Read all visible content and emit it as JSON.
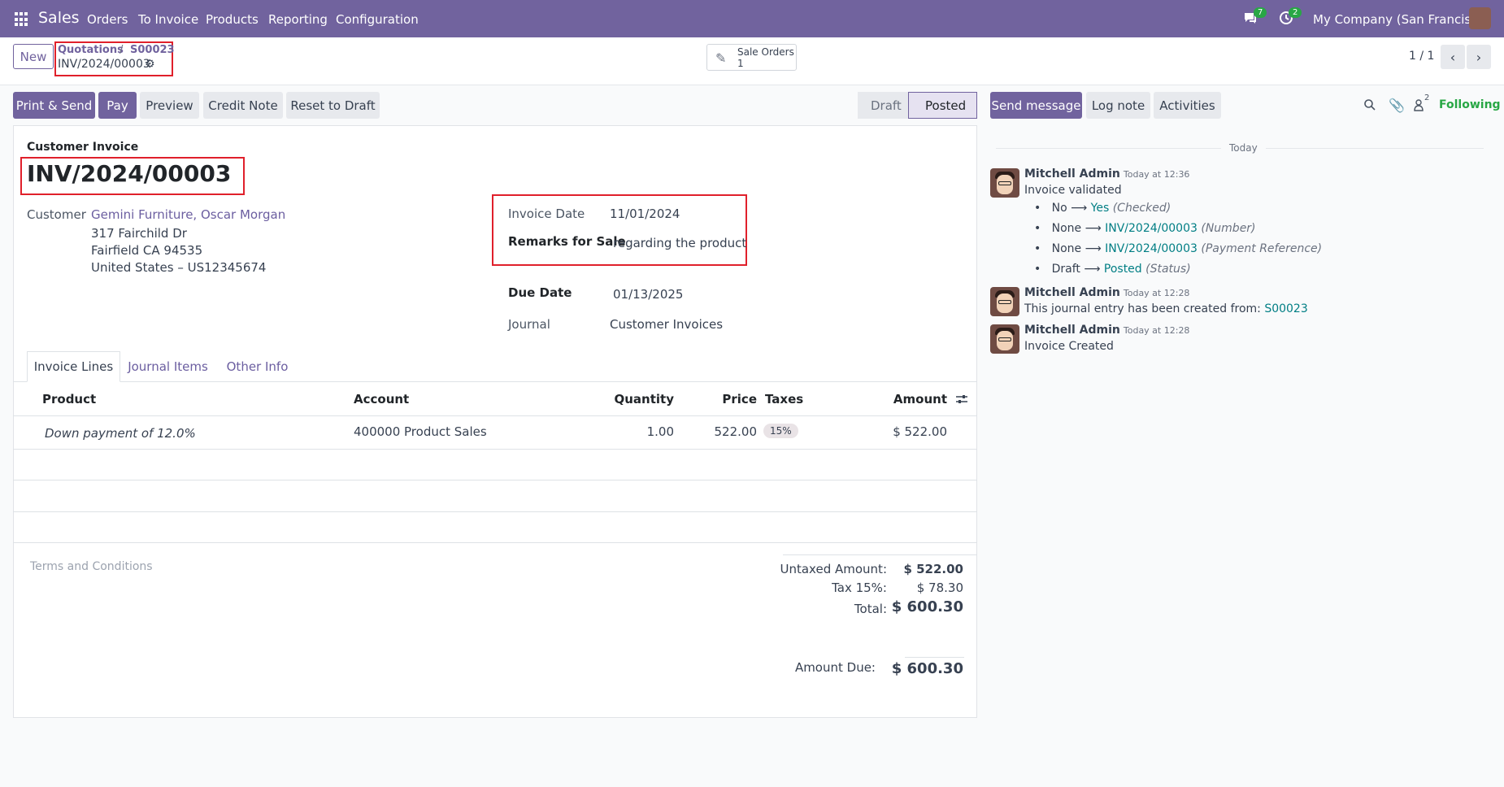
{
  "navbar": {
    "brand": "Sales",
    "menu": [
      "Orders",
      "To Invoice",
      "Products",
      "Reporting",
      "Configuration"
    ],
    "messages_badge": "7",
    "activities_badge": "2",
    "company": "My Company (San Francisco)"
  },
  "control_panel": {
    "new_label": "New",
    "breadcrumb": [
      "Quotations",
      "S00023"
    ],
    "record_name": "INV/2024/00003",
    "smart_button_label": "Sale Orders",
    "smart_button_count": "1",
    "pager": "1 / 1"
  },
  "actions": {
    "buttons": [
      "Print & Send",
      "Pay",
      "Preview",
      "Credit Note",
      "Reset to Draft"
    ],
    "status_steps": [
      "Draft",
      "Posted"
    ],
    "active_status": "Posted"
  },
  "invoice": {
    "type_label": "Customer Invoice",
    "number": "INV/2024/00003",
    "customer_label": "Customer",
    "customer_name": "Gemini Furniture, Oscar Morgan",
    "address_lines": [
      "317 Fairchild Dr",
      "Fairfield CA 94535",
      "United States – US12345674"
    ],
    "invoice_date_label": "Invoice Date",
    "invoice_date": "11/01/2024",
    "remarks_label": "Remarks for Sale",
    "remarks": "regarding the product",
    "due_date_label": "Due Date",
    "due_date": "01/13/2025",
    "journal_label": "Journal",
    "journal": "Customer Invoices"
  },
  "tabs": [
    "Invoice Lines",
    "Journal Items",
    "Other Info"
  ],
  "lines": {
    "columns": [
      "Product",
      "Account",
      "Quantity",
      "Price",
      "Taxes",
      "Amount"
    ],
    "rows": [
      {
        "product": "Down payment of 12.0%",
        "account": "400000 Product Sales",
        "quantity": "1.00",
        "price": "522.00",
        "taxes": "15%",
        "amount": "$ 522.00"
      }
    ]
  },
  "terms_placeholder": "Terms and Conditions",
  "totals": {
    "untaxed_label": "Untaxed Amount:",
    "untaxed": "$ 522.00",
    "tax_label": "Tax 15%:",
    "tax": "$ 78.30",
    "total_label": "Total:",
    "total": "$ 600.30",
    "due_label": "Amount Due:",
    "due": "$ 600.30"
  },
  "chatter": {
    "send_message": "Send message",
    "log_note": "Log note",
    "activities": "Activities",
    "followers_count": "2",
    "following": "Following",
    "date_separator": "Today",
    "messages": [
      {
        "author": "Mitchell Admin",
        "time": "Today at 12:36",
        "body": "Invoice validated",
        "changes": [
          {
            "old": "No",
            "new": "Yes",
            "field": "(Checked)"
          },
          {
            "old": "None",
            "new": "INV/2024/00003",
            "field": "(Number)"
          },
          {
            "old": "None",
            "new": "INV/2024/00003",
            "field": "(Payment Reference)"
          },
          {
            "old": "Draft",
            "new": "Posted",
            "field": "(Status)"
          }
        ]
      },
      {
        "author": "Mitchell Admin",
        "time": "Today at 12:28",
        "body": "This journal entry has been created from:",
        "link": "S00023"
      },
      {
        "author": "Mitchell Admin",
        "time": "Today at 12:28",
        "body": "Invoice Created"
      }
    ]
  }
}
